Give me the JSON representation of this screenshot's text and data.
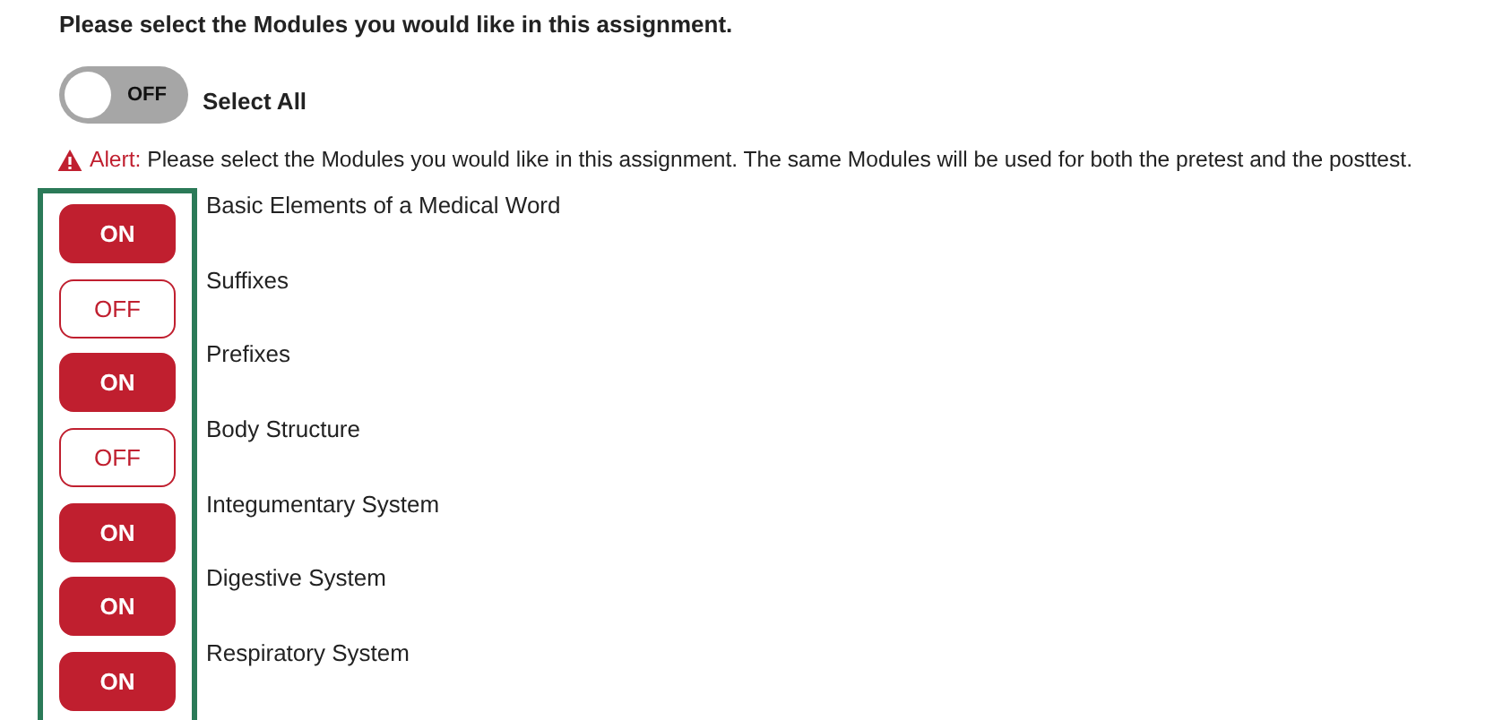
{
  "heading": "Please select the Modules you would like in this assignment.",
  "select_all": {
    "toggle_label": "OFF",
    "on": false,
    "label": "Select All"
  },
  "alert": {
    "label": "Alert:",
    "message": "Please select the Modules you would like in this assignment. The same Modules will be used for both the pretest and the posttest."
  },
  "modules": [
    {
      "toggle_label": "ON",
      "on": true,
      "name": "Basic Elements of a Medical Word"
    },
    {
      "toggle_label": "OFF",
      "on": false,
      "name": "Suffixes"
    },
    {
      "toggle_label": "ON",
      "on": true,
      "name": "Prefixes"
    },
    {
      "toggle_label": "OFF",
      "on": false,
      "name": "Body Structure"
    },
    {
      "toggle_label": "ON",
      "on": true,
      "name": "Integumentary System"
    },
    {
      "toggle_label": "ON",
      "on": true,
      "name": "Digestive System"
    },
    {
      "toggle_label": "ON",
      "on": true,
      "name": "Respiratory System"
    }
  ]
}
